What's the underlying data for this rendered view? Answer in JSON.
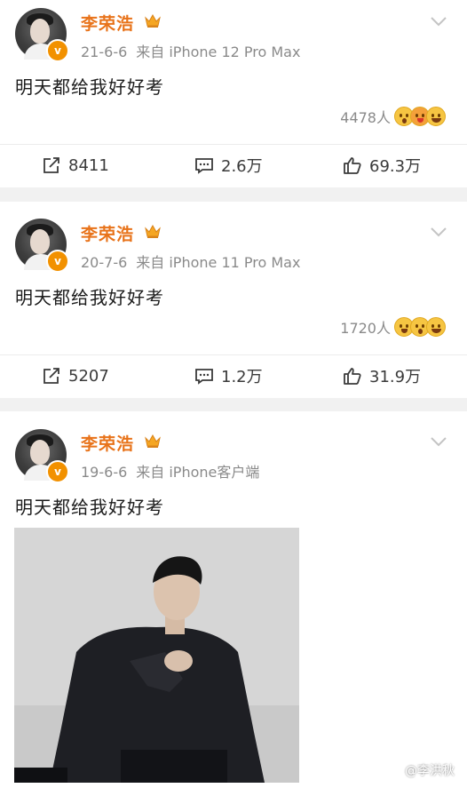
{
  "posts": [
    {
      "username": "李荣浩",
      "date": "21-6-6",
      "source": "来自 iPhone 12 Pro Max",
      "text": "明天都给我好好考",
      "reaction_count": "4478人",
      "reposts": "8411",
      "comments": "2.6万",
      "likes": "69.3万"
    },
    {
      "username": "李荣浩",
      "date": "20-7-6",
      "source": "来自 iPhone 11 Pro Max",
      "text": "明天都给我好好考",
      "reaction_count": "1720人",
      "reposts": "5207",
      "comments": "1.2万",
      "likes": "31.9万"
    },
    {
      "username": "李荣浩",
      "date": "19-6-6",
      "source": "来自 iPhone客户端",
      "text": "明天都给我好好考",
      "has_photo": true
    }
  ],
  "watermark": "@李洪秋",
  "colors": {
    "username": "#e8731a",
    "verified_badge": "#f29100",
    "meta": "#8a8a8a",
    "background": "#f1f1f1"
  },
  "icons": {
    "verified": "verified-v-icon",
    "crown": "crown-icon",
    "expand": "chevron-down-icon",
    "repost": "share-arrow-icon",
    "comment": "comment-bubble-icon",
    "like": "thumbs-up-icon"
  }
}
